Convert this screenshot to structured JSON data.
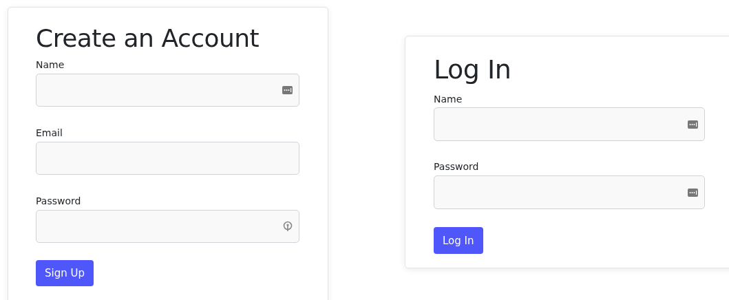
{
  "forms": [
    {
      "title": "Create an Account",
      "fields": [
        {
          "label": "Name",
          "kind": "autofill"
        },
        {
          "label": "Email",
          "kind": "plain"
        },
        {
          "label": "Password",
          "kind": "key"
        }
      ],
      "button": "Sign Up"
    },
    {
      "title": "Log In",
      "fields": [
        {
          "label": "Name",
          "kind": "autofill"
        },
        {
          "label": "Password",
          "kind": "autofill"
        }
      ],
      "button": "Log In"
    }
  ]
}
